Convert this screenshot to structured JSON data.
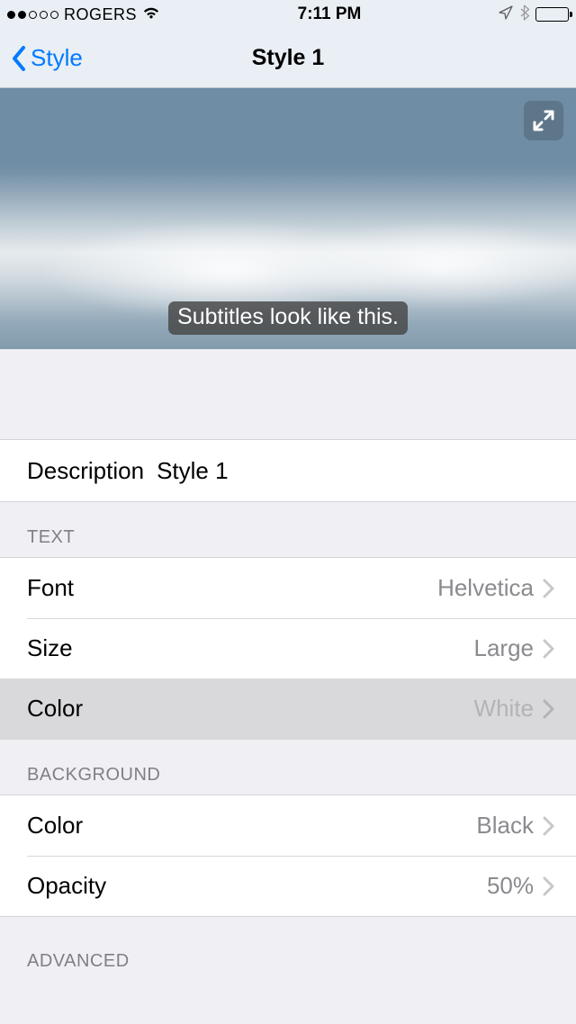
{
  "status": {
    "carrier": "ROGERS",
    "time": "7:11 PM"
  },
  "nav": {
    "back_label": "Style",
    "title": "Style 1"
  },
  "preview": {
    "subtitle_sample": "Subtitles look like this."
  },
  "description": {
    "label": "Description",
    "value": "Style 1"
  },
  "sections": {
    "text": {
      "header": "TEXT",
      "rows": {
        "font": {
          "label": "Font",
          "value": "Helvetica"
        },
        "size": {
          "label": "Size",
          "value": "Large"
        },
        "color": {
          "label": "Color",
          "value": "White"
        }
      }
    },
    "background": {
      "header": "BACKGROUND",
      "rows": {
        "color": {
          "label": "Color",
          "value": "Black"
        },
        "opacity": {
          "label": "Opacity",
          "value": "50%"
        }
      }
    },
    "advanced": {
      "header": "ADVANCED"
    }
  }
}
